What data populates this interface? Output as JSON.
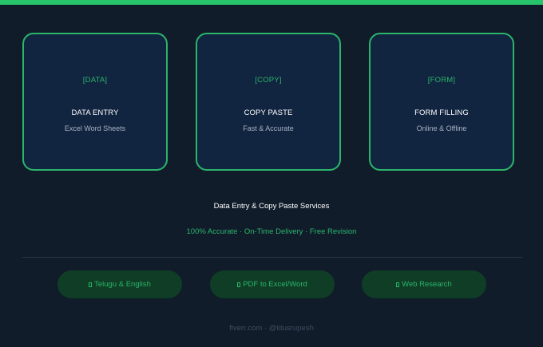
{
  "colors": {
    "background": "#111c2b",
    "accent": "#27c46b",
    "card_bg": "#112440",
    "pill_bg": "#0f3d25",
    "muted": "#a8b3c2"
  },
  "cards": [
    {
      "tag": "[DATA]",
      "title": "DATA ENTRY",
      "subtitle": "Excel  Word  Sheets"
    },
    {
      "tag": "[COPY]",
      "title": "COPY PASTE",
      "subtitle": "Fast & Accurate"
    },
    {
      "tag": "[FORM]",
      "title": "FORM FILLING",
      "subtitle": "Online & Offline"
    }
  ],
  "headline": "Data Entry & Copy Paste Services",
  "tagline": "100% Accurate · On-Time Delivery · Free Revision",
  "pills": [
    {
      "label": "Telugu & English"
    },
    {
      "label": "PDF to Excel/Word"
    },
    {
      "label": "Web Research"
    }
  ],
  "footer": "fiverr.com · @titusrupesh"
}
